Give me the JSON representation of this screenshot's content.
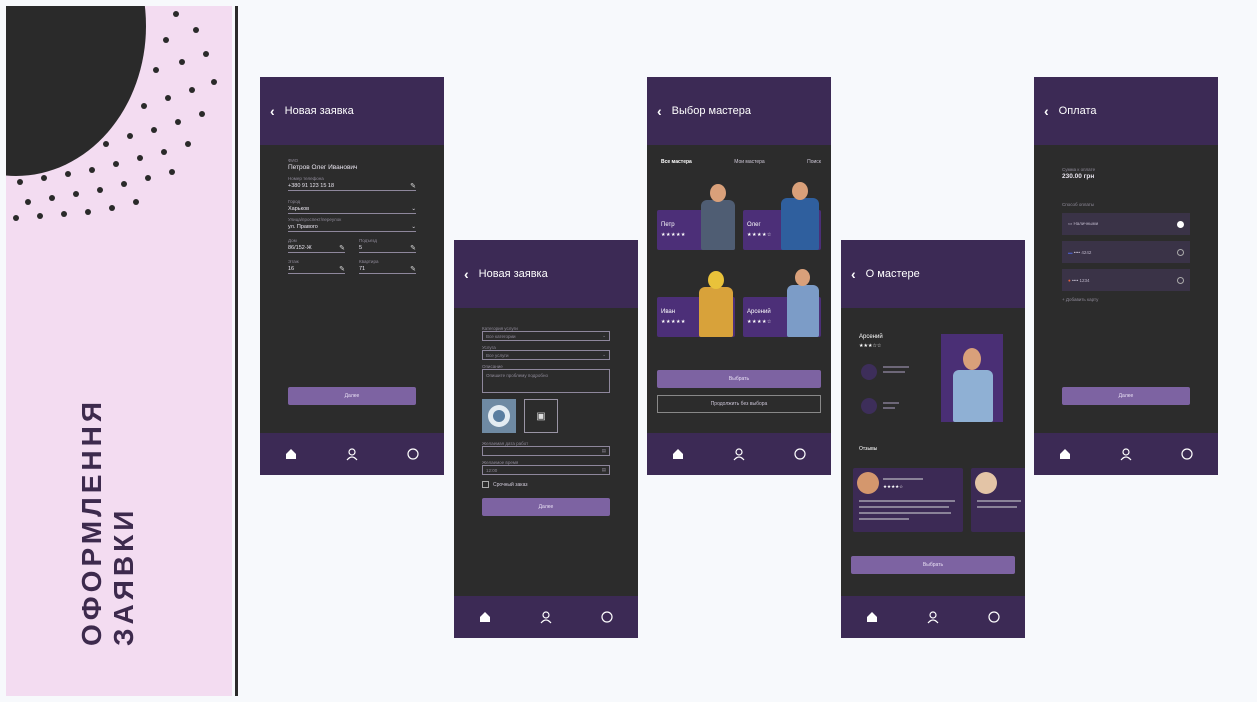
{
  "section_title": {
    "line1": "ОФОРМЛЕННЯ",
    "line2": "ЗАЯВКИ"
  },
  "colors": {
    "panel_bg": "#f3dcf1",
    "phone_bg": "#2c2c2c",
    "header_bg": "#3c2a55",
    "accent": "#7d63a2",
    "title": "#3d2a4d"
  },
  "screen1": {
    "title": "Новая заявка",
    "name_label": "ФИО",
    "name_value": "Петров Олег Иванович",
    "phone_label": "Номер телефона",
    "phone_value": "+380 91 123 15 18",
    "city_label": "Город",
    "city_value": "Харьков",
    "street_label": "Улица/проспект/переулок",
    "street_value": "ул. Правого",
    "house_label": "Дом",
    "house_value": "86/152-Ж",
    "entrance_label": "Подъезд",
    "entrance_value": "5",
    "floor_label": "Этаж",
    "floor_value": "16",
    "apt_label": "Квартира",
    "apt_value": "71",
    "submit": "Далее"
  },
  "screen2": {
    "title": "Новая заявка",
    "category_label": "Категория услуги",
    "category_placeholder": "Все категории",
    "service_label": "Услуга",
    "service_placeholder": "Все услуги",
    "desc_label": "Описание",
    "desc_placeholder": "Опишите проблему подробно",
    "date_label": "Желаемая дата работ",
    "time_label": "Желаемое время",
    "time_value": "12:00",
    "urgent_label": "Срочный заказ",
    "submit": "Далее"
  },
  "screen3": {
    "title": "Выбор мастера",
    "tabs": [
      "Все мастера",
      "Мои мастера",
      "Поиск"
    ],
    "masters": [
      {
        "name": "Петр",
        "stars": "★★★★★"
      },
      {
        "name": "Олег",
        "stars": "★★★★☆"
      },
      {
        "name": "Иван",
        "stars": "★★★★★"
      },
      {
        "name": "Арсений",
        "stars": "★★★★☆"
      }
    ],
    "choose_btn": "Выбрать",
    "skip_btn": "Продолжить без выбора"
  },
  "screen4": {
    "title": "О мастере",
    "master_name": "Арсений",
    "master_stars": "★★★☆☆",
    "reviews_label": "Отзывы",
    "choose_btn": "Выбрать"
  },
  "screen5": {
    "title": "Оплата",
    "sum_label": "Сумма к оплате",
    "sum_value": "230.00 грн",
    "method_label": "Способ оплаты",
    "methods": [
      "Наличными",
      "•••• 4242",
      "•••• 1234"
    ],
    "add_card": "+ Добавить карту",
    "submit": "Далее"
  }
}
